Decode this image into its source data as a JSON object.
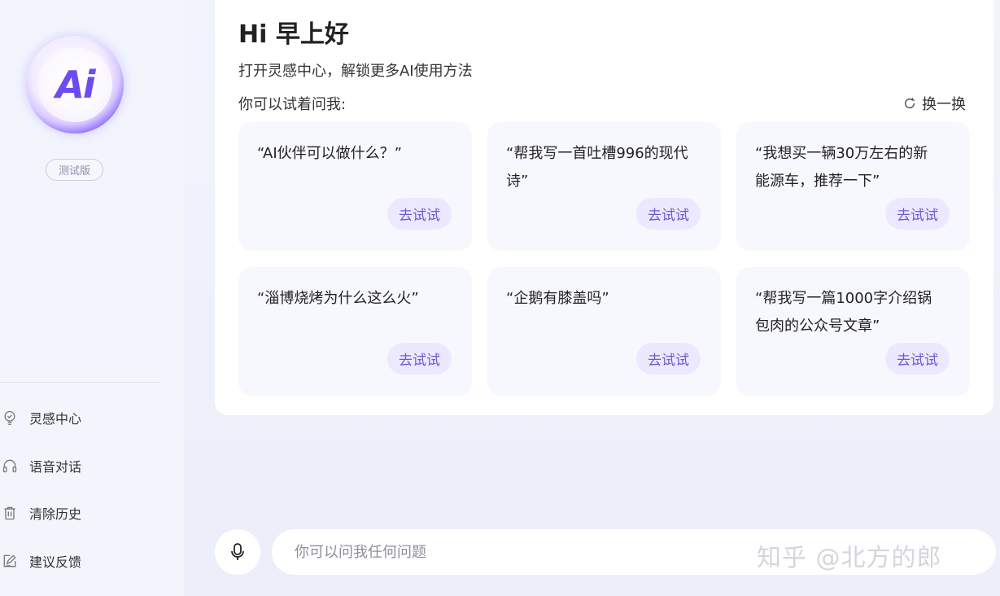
{
  "sidebar": {
    "logo_text": "Ai",
    "version_badge": "测试版",
    "menu": [
      {
        "label": "灵感中心",
        "icon": "lightbulb-icon"
      },
      {
        "label": "语音对话",
        "icon": "headphones-icon"
      },
      {
        "label": "清除历史",
        "icon": "trash-icon"
      },
      {
        "label": "建议反馈",
        "icon": "feedback-edit-icon"
      }
    ]
  },
  "main": {
    "greeting": "Hi 早上好",
    "subtitle": "打开灵感中心，解锁更多AI使用方法",
    "prompt_label": "你可以试着问我:",
    "refresh_label": "换一换",
    "try_label": "去试试",
    "questions": [
      "“AI伙伴可以做什么？”",
      "“帮我写一首吐槽996的现代诗”",
      "“我想买一辆30万左右的新能源车，推荐一下”",
      "“淄博烧烤为什么这么火”",
      "“企鹅有膝盖吗”",
      "“帮我写一篇1000字介绍锅包肉的公众号文章”"
    ]
  },
  "input": {
    "placeholder": "你可以问我任何问题",
    "value": ""
  },
  "watermark": "知乎 @北方的郎",
  "colors": {
    "accent": "#6e58d6",
    "try_button_bg": "#ece8fd",
    "card_bg": "#f7f8fd",
    "page_bg": "#f1f3fd"
  }
}
